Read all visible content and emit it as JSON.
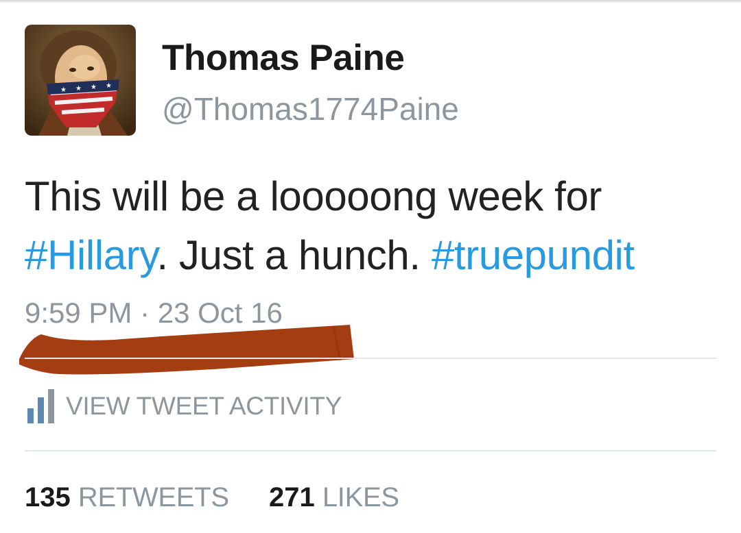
{
  "user": {
    "display_name": "Thomas Paine",
    "handle": "@Thomas1774Paine"
  },
  "tweet": {
    "text_before": "This will be a looooong week for ",
    "hashtag_1": "#Hillary",
    "text_middle": ". Just a hunch. ",
    "hashtag_2": "#truepundit",
    "timestamp": "9:59 PM · 23 Oct 16"
  },
  "activity": {
    "label": "VIEW TWEET ACTIVITY",
    "icon": "bar-chart-icon"
  },
  "stats": {
    "retweets_count": "135",
    "retweets_label": "RETWEETS",
    "likes_count": "271",
    "likes_label": "LIKES"
  },
  "colors": {
    "hashtag": "#2a9ae0",
    "secondary_text": "#8d959d",
    "redaction": "#a53d12"
  }
}
